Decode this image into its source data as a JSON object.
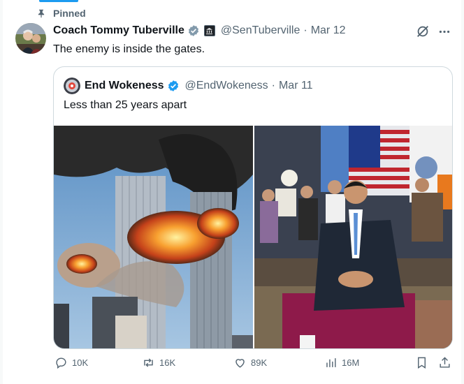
{
  "pinned_label": "Pinned",
  "tweet": {
    "author_name": "Coach Tommy Tuberville",
    "handle": "@SenTuberville",
    "separator": "·",
    "date": "Mar 12",
    "text": "The enemy is inside the gates."
  },
  "quote": {
    "author_name": "End Wokeness",
    "handle": "@EndWokeness",
    "separator": "·",
    "date": "Mar 11",
    "text": "Less than 25 years apart"
  },
  "actions": {
    "replies": "10K",
    "reposts": "16K",
    "likes": "89K",
    "views": "16M"
  },
  "colors": {
    "accent": "#1d9bf0",
    "secondary_text": "#536471",
    "border": "#cfd9de"
  },
  "icons": [
    "pin-icon",
    "verified-badge-icon",
    "government-badge-icon",
    "grok-icon",
    "more-icon",
    "reply-icon",
    "repost-icon",
    "like-icon",
    "views-icon",
    "bookmark-icon",
    "share-icon"
  ]
}
